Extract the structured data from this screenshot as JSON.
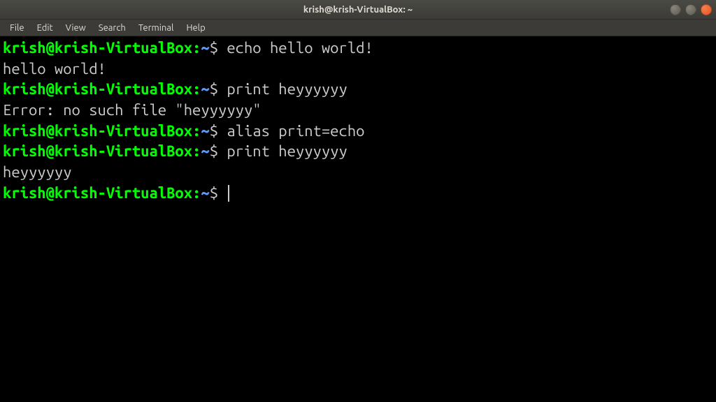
{
  "window": {
    "title": "krish@krish-VirtualBox: ~"
  },
  "menubar": {
    "items": [
      "File",
      "Edit",
      "View",
      "Search",
      "Terminal",
      "Help"
    ]
  },
  "prompt": {
    "user_host": "krish@krish-VirtualBox",
    "sep": ":",
    "path": "~",
    "sigil": "$"
  },
  "session": [
    {
      "type": "cmd",
      "text": "echo hello world!"
    },
    {
      "type": "out",
      "text": "hello world!"
    },
    {
      "type": "cmd",
      "text": "print heyyyyyy"
    },
    {
      "type": "out",
      "text": "Error: no such file \"heyyyyyy\""
    },
    {
      "type": "cmd",
      "text": "alias print=echo"
    },
    {
      "type": "cmd",
      "text": "print heyyyyyy"
    },
    {
      "type": "out",
      "text": "heyyyyyy"
    },
    {
      "type": "cmd",
      "text": "",
      "cursor": true
    }
  ]
}
